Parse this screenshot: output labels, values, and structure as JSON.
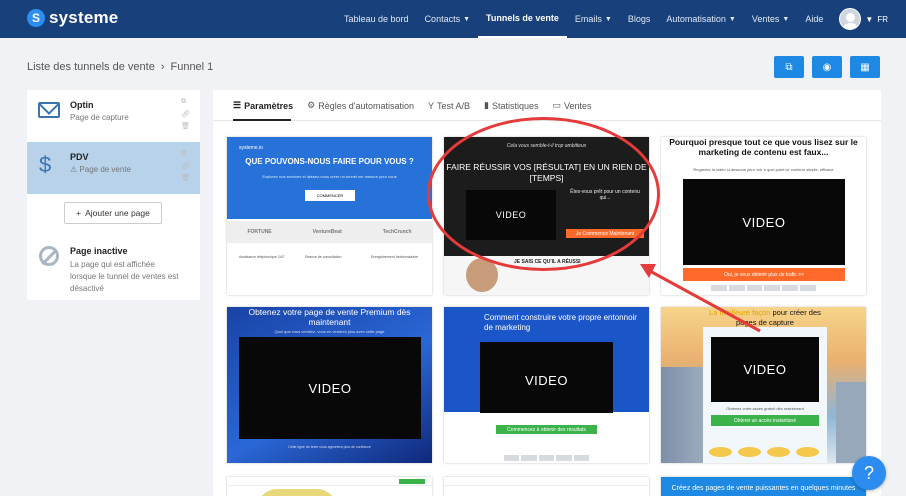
{
  "brand": {
    "name": "systeme",
    "mark": "S"
  },
  "nav": {
    "items": [
      {
        "label": "Tableau de bord",
        "caret": false
      },
      {
        "label": "Contacts",
        "caret": true
      },
      {
        "label": "Tunnels de vente",
        "caret": false
      },
      {
        "label": "Emails",
        "caret": true
      },
      {
        "label": "Blogs",
        "caret": false
      },
      {
        "label": "Automatisation",
        "caret": true
      },
      {
        "label": "Ventes",
        "caret": true
      },
      {
        "label": "Aide",
        "caret": false
      }
    ],
    "active": "Tunnels de vente",
    "language": "FR"
  },
  "breadcrumb": {
    "parent": "Liste des tunnels de vente",
    "separator": "›",
    "current": "Funnel 1"
  },
  "actions": [
    {
      "icon": "external-link-icon"
    },
    {
      "icon": "eye-icon"
    },
    {
      "icon": "shop-icon"
    }
  ],
  "steps": [
    {
      "title": "Optin",
      "subtitle": "Page de capture",
      "icon": "envelope-icon",
      "active": false
    },
    {
      "title": "PDV",
      "subtitle": "Page de vente",
      "icon": "dollar-icon",
      "warning": "⚠",
      "active": true
    }
  ],
  "add_step": {
    "plus": "+",
    "label": "Ajouter une page"
  },
  "inactive_page": {
    "title": "Page inactive",
    "text": "La page qui est affichée lorsque le tunnel de ventes est désactivé"
  },
  "tabs": [
    {
      "icon": "☰",
      "label": "Paramètres"
    },
    {
      "icon": "⚙",
      "label": "Règles d'automatisation"
    },
    {
      "icon": "Y",
      "label": "Test A/B"
    },
    {
      "icon": "▮",
      "label": "Statistiques"
    },
    {
      "icon": "▭",
      "label": "Ventes"
    }
  ],
  "active_tab": "Paramètres",
  "templates": {
    "t1": {
      "brand": "systeme.io",
      "heading": "QUE POUVONS-NOUS FAIRE POUR VOUS ?",
      "sub": "Explorez nos services et laissez-nous créer un tunnel sur mesure pour vous",
      "cta": "COMMENCER",
      "logos": [
        "FORTUNE",
        "VentureBeat",
        "TechCrunch"
      ],
      "features": [
        "Assistance téléphonique 24/7",
        "Séance de consultation",
        "Enregistrement hebdomadaire"
      ]
    },
    "t2": {
      "top": "Cela vous semble-t-il trop ambitieux",
      "heading": "FAIRE RÉUSSIR VOS [RÉSULTAT] EN UN RIEN DE [TEMPS]",
      "video": "VIDEO",
      "side": "Êtes-vous prêt pour un contenu qui...",
      "button": "Je Commence Maintenant",
      "lower": "JE SAIS CE QU'IL A RÉUSSI"
    },
    "t3": {
      "heading": "Pourquoi presque tout ce que vous lisez sur le marketing de contenu est faux...",
      "sub": "Regardez la vidéo ci-dessous pour voir à quel point ce contenu simple, efficace",
      "video": "VIDEO",
      "button": "Oui, je veux obtenir plus de trafic >>"
    },
    "t4": {
      "heading": "Obtenez votre page de vente Premium dès maintenant",
      "sub": "Quoi que vous vendiez, vous en vendrez plus avec cette page",
      "video": "VIDEO",
      "footer": "Cette ligne de texte vous apportera plus de confiance"
    },
    "t5": {
      "heading": "Comment construire votre propre entonnoir de marketing",
      "video": "VIDEO",
      "button": "Commencez à obtenir des résultats"
    },
    "t6": {
      "heading_highlight": "La meilleure façon",
      "heading_rest": " pour créer des pages de capture",
      "video": "VIDEO",
      "sub": "Obtenez votre accès gratuit dès maintenant",
      "button": "Obtenir un accès instantané"
    },
    "t9": {
      "heading": "Créez des pages de vente puissantes en quelques minutes"
    }
  },
  "help": {
    "label": "?"
  },
  "colors": {
    "nav_bg": "#18407a",
    "primary": "#1e88e5",
    "annotation": "#e63b3b",
    "active_step": "#b8d2ea"
  }
}
